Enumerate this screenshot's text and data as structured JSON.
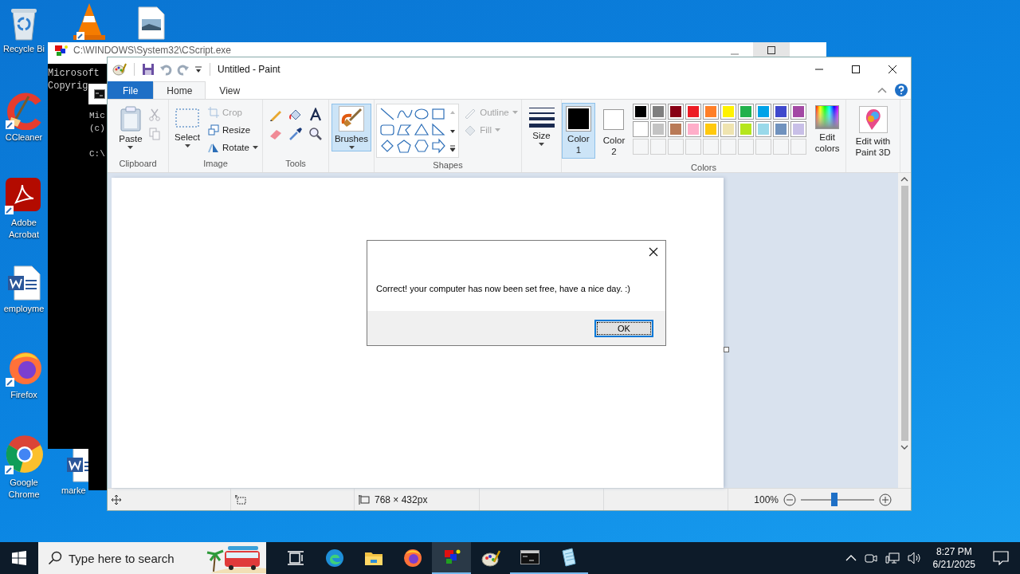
{
  "desktop_icons": [
    {
      "kind": "recycle",
      "label": "Recycle Bi"
    },
    {
      "kind": "cone"
    },
    {
      "kind": "image"
    },
    {
      "kind": "ccleaner",
      "label": "CCleaner"
    },
    {
      "kind": "acrobat",
      "label": "Adobe Acrobat"
    },
    {
      "kind": "word",
      "label": "employme"
    },
    {
      "kind": "firefox",
      "label": "Firefox"
    },
    {
      "kind": "chrome",
      "label": "Google Chrome"
    },
    {
      "kind": "word",
      "label": "marke"
    }
  ],
  "script_window": {
    "title": "C:\\WINDOWS\\System32\\CScript.exe",
    "lines": [
      "Microsoft",
      "Copyrig"
    ]
  },
  "console_window": {
    "lines": [
      "Mic",
      "(c)",
      "C:\\"
    ]
  },
  "paint": {
    "title": "Untitled - Paint",
    "tabs": [
      {
        "label": "File",
        "kind": "menu",
        "selected": false
      },
      {
        "label": "Home",
        "kind": "tab",
        "selected": true
      },
      {
        "label": "View",
        "kind": "tab",
        "selected": false
      }
    ],
    "ribbon": {
      "clipboard": {
        "label": "Clipboard",
        "paste": "Paste",
        "cut_disabled": true,
        "copy_disabled": true
      },
      "image": {
        "label": "Image",
        "select": "Select",
        "commands": [
          {
            "kind": "crop",
            "label": "Crop",
            "disabled": true
          },
          {
            "kind": "resize",
            "label": "Resize",
            "disabled": false
          },
          {
            "kind": "rotate",
            "label": "Rotate",
            "disabled": false
          }
        ]
      },
      "tools": {
        "label": "Tools"
      },
      "brushes": {
        "label": "Brushes",
        "selected": true
      },
      "shapes": {
        "label": "Shapes",
        "options": [
          {
            "kind": "outline",
            "label": "Outline",
            "disabled": true
          },
          {
            "kind": "fill",
            "label": "Fill",
            "disabled": true
          }
        ]
      },
      "size": {
        "label": "Size"
      },
      "colors": {
        "label": "Colors",
        "slots": [
          {
            "label": "Color 1",
            "color": "#000000",
            "selected": true
          },
          {
            "label": "Color 2",
            "color": "#ffffff",
            "selected": false
          }
        ],
        "palette": [
          {
            "kind": "swatch",
            "color": "#000000"
          },
          {
            "kind": "swatch",
            "color": "#7f7f7f"
          },
          {
            "kind": "swatch",
            "color": "#880015"
          },
          {
            "kind": "swatch",
            "color": "#ed1c24"
          },
          {
            "kind": "swatch",
            "color": "#ff7f27"
          },
          {
            "kind": "swatch",
            "color": "#fff200"
          },
          {
            "kind": "swatch",
            "color": "#22b14c"
          },
          {
            "kind": "swatch",
            "color": "#00a2e8"
          },
          {
            "kind": "swatch",
            "color": "#3f48cc"
          },
          {
            "kind": "swatch",
            "color": "#a349a4"
          },
          {
            "kind": "swatch",
            "color": "#ffffff"
          },
          {
            "kind": "swatch",
            "color": "#c3c3c3"
          },
          {
            "kind": "swatch",
            "color": "#b97a57"
          },
          {
            "kind": "swatch",
            "color": "#ffaec9"
          },
          {
            "kind": "swatch",
            "color": "#ffc90e"
          },
          {
            "kind": "swatch",
            "color": "#efe4b0"
          },
          {
            "kind": "swatch",
            "color": "#b5e61d"
          },
          {
            "kind": "swatch",
            "color": "#99d9ea"
          },
          {
            "kind": "swatch",
            "color": "#7092be"
          },
          {
            "kind": "swatch",
            "color": "#c8bfe7"
          },
          {
            "kind": "empty"
          },
          {
            "kind": "empty"
          },
          {
            "kind": "empty"
          },
          {
            "kind": "empty"
          },
          {
            "kind": "empty"
          },
          {
            "kind": "empty"
          },
          {
            "kind": "empty"
          },
          {
            "kind": "empty"
          },
          {
            "kind": "empty"
          },
          {
            "kind": "empty"
          }
        ],
        "edit_colors": "Edit colors"
      },
      "paint3d": "Edit with Paint 3D"
    },
    "status": {
      "dimensions": "768 × 432px",
      "zoom": "100%",
      "zoom_slider": {
        "level": 0.46
      }
    }
  },
  "dialog": {
    "message": "Correct! your computer has now been set free, have a nice day. :)",
    "button": "OK"
  },
  "taskbar": {
    "search_placeholder": "Type here to search",
    "apps": [
      {
        "kind": "taskview",
        "selected": false,
        "running": false
      },
      {
        "kind": "edge",
        "selected": false,
        "running": false
      },
      {
        "kind": "explorer",
        "selected": false,
        "running": false
      },
      {
        "kind": "firefox",
        "selected": false,
        "running": false
      },
      {
        "kind": "script",
        "selected": true,
        "running": true
      },
      {
        "kind": "paint",
        "selected": false,
        "running": false
      },
      {
        "kind": "console",
        "selected": false,
        "running": true
      },
      {
        "kind": "notepad",
        "selected": false,
        "running": true
      }
    ],
    "time": "8:27 PM",
    "date": "6/21/2025"
  }
}
